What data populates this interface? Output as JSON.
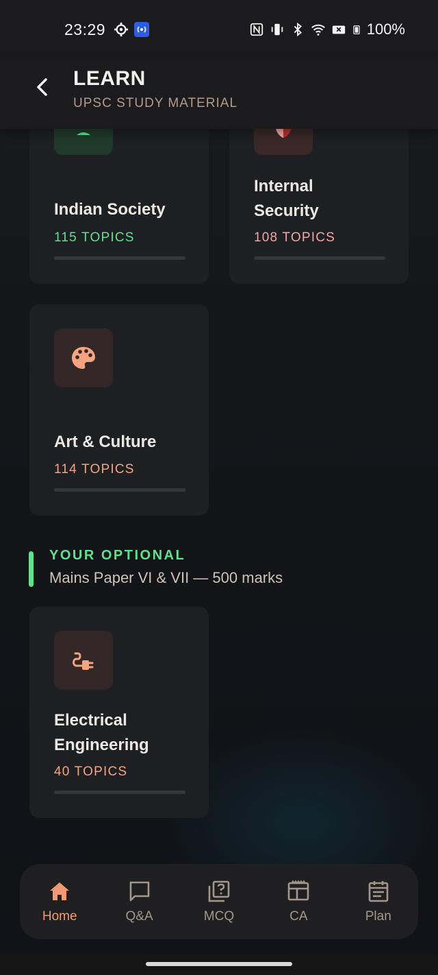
{
  "status_bar": {
    "time": "23:29",
    "battery": "100%"
  },
  "header": {
    "title": "LEARN",
    "subtitle": "UPSC STUDY MATERIAL"
  },
  "cards": {
    "indian_society": {
      "title": "Indian Society",
      "count": "115 TOPICS",
      "accent": "#5fe28e"
    },
    "internal_security": {
      "title": "Internal Security",
      "count": "108 TOPICS",
      "accent": "#f2a7a4"
    },
    "art_culture": {
      "title": "Art & Culture",
      "count": "114 TOPICS",
      "accent": "#f4a47e",
      "icon": "palette-icon"
    },
    "electrical": {
      "title": "Electrical Engineering",
      "count": "40 TOPICS",
      "accent": "#f4a47e",
      "icon": "plug-icon"
    }
  },
  "optional": {
    "label": "YOUR OPTIONAL",
    "subtitle": "Mains Paper VI & VII — 500 marks"
  },
  "nav": {
    "items": [
      {
        "label": "Home",
        "icon": "home-icon",
        "active": true
      },
      {
        "label": "Q&A",
        "icon": "chat-icon",
        "active": false
      },
      {
        "label": "MCQ",
        "icon": "question-icon",
        "active": false
      },
      {
        "label": "CA",
        "icon": "newspaper-icon",
        "active": false
      },
      {
        "label": "Plan",
        "icon": "calendar-icon",
        "active": false
      }
    ]
  }
}
